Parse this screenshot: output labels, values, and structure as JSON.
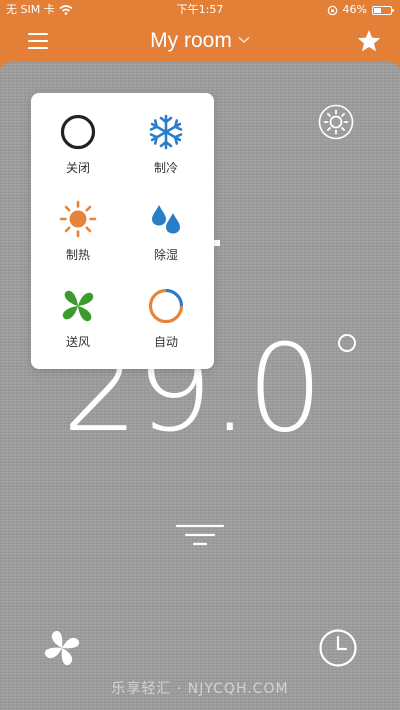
{
  "status_bar": {
    "carrier": "无 SIM 卡",
    "time": "下午1:57",
    "battery_text": "46%",
    "battery_level": 0.46
  },
  "nav": {
    "title": "My room",
    "menu_icon": "hamburger-menu-icon",
    "star_icon": "star-icon"
  },
  "main": {
    "temperature": "29.0",
    "watermark": "乐享轻汇 · NJYCQH.COM"
  },
  "mode_menu": {
    "items": [
      {
        "label": "关闭",
        "icon": "power-off-icon",
        "color": "#222222"
      },
      {
        "label": "制冷",
        "icon": "snowflake-icon",
        "color": "#2a7ec9"
      },
      {
        "label": "制热",
        "icon": "sun-icon",
        "color": "#e7843b"
      },
      {
        "label": "除湿",
        "icon": "water-drops-icon",
        "color": "#2a7ec9"
      },
      {
        "label": "送风",
        "icon": "fan-icon",
        "color": "#3d9a2e"
      },
      {
        "label": "自动",
        "icon": "auto-cycle-icon",
        "color": "#e7843b"
      }
    ]
  },
  "colors": {
    "header": "#e37f37",
    "background": "#9e9e9e"
  }
}
